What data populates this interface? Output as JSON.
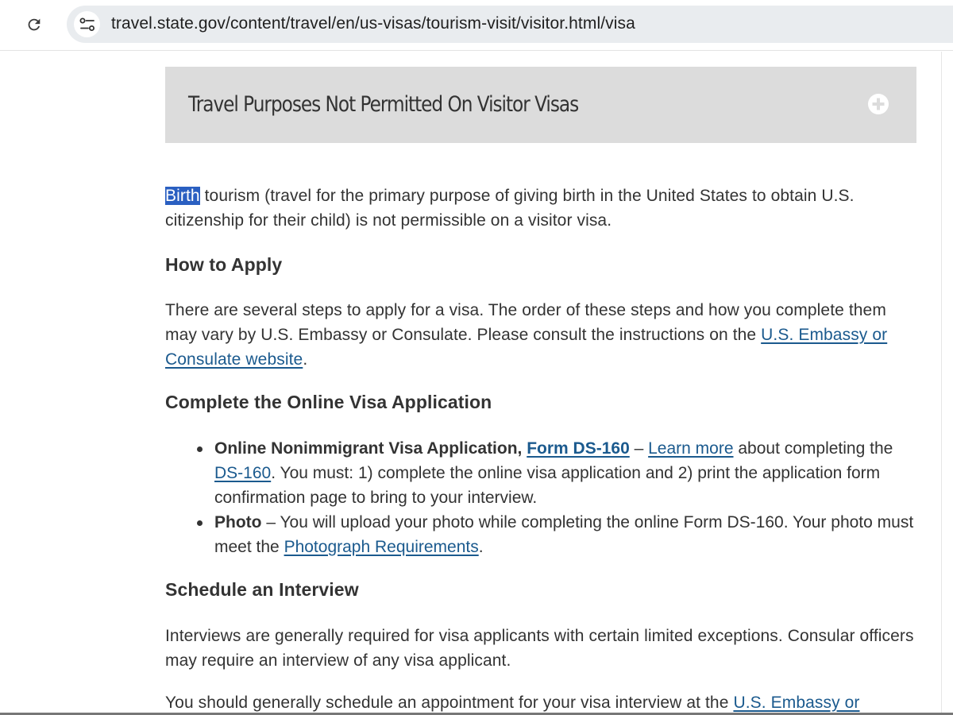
{
  "browser": {
    "url": "travel.state.gov/content/travel/en/us-visas/tourism-visit/visitor.html/visa",
    "reload_icon": "reload-icon",
    "site_info_icon": "tune-icon"
  },
  "accordion": {
    "title": "Travel Purposes Not Permitted On Visitor Visas",
    "icon": "plus-circle-icon"
  },
  "birth_paragraph": {
    "selected_word": "Birth",
    "rest": " tourism (travel for the primary purpose of giving birth in the United States to obtain U.S. citizenship for their child) is not permissible on a visitor visa."
  },
  "how_to_apply": {
    "heading": "How to Apply",
    "text": "There are several steps to apply for a visa. The order of these steps and how you complete them may vary by U.S. Embassy or Consulate. Please consult the instructions on the ",
    "link": "U.S. Embassy or Consulate website",
    "end": "."
  },
  "complete_application": {
    "heading": "Complete the Online Visa Application",
    "items": [
      {
        "bold": "Online Nonimmigrant Visa Application, ",
        "form_link": "Form DS-160",
        "dash": " – ",
        "learn_link": "Learn more",
        "mid": " about completing the ",
        "ds_link": "DS-160",
        "text": ". You must: 1) complete the online visa application and 2) print the application form confirmation page to bring to your interview."
      },
      {
        "bold": "Photo",
        "text": " – You will upload your photo while completing the online Form DS-160. Your photo must meet the ",
        "link": "Photograph Requirements",
        "end": "."
      }
    ]
  },
  "schedule_interview": {
    "heading": "Schedule an Interview",
    "text1": "Interviews are generally required for visa applicants with certain limited exceptions. Consular officers may require an interview of any visa applicant.",
    "text2": "You should generally schedule an appointment for your visa interview at the ",
    "link2": "U.S. Embassy or"
  },
  "colors": {
    "link": "#1b5a8e",
    "selection": "#2a5fc1",
    "accordion_bg": "#dcdcdc",
    "text": "#333333"
  }
}
